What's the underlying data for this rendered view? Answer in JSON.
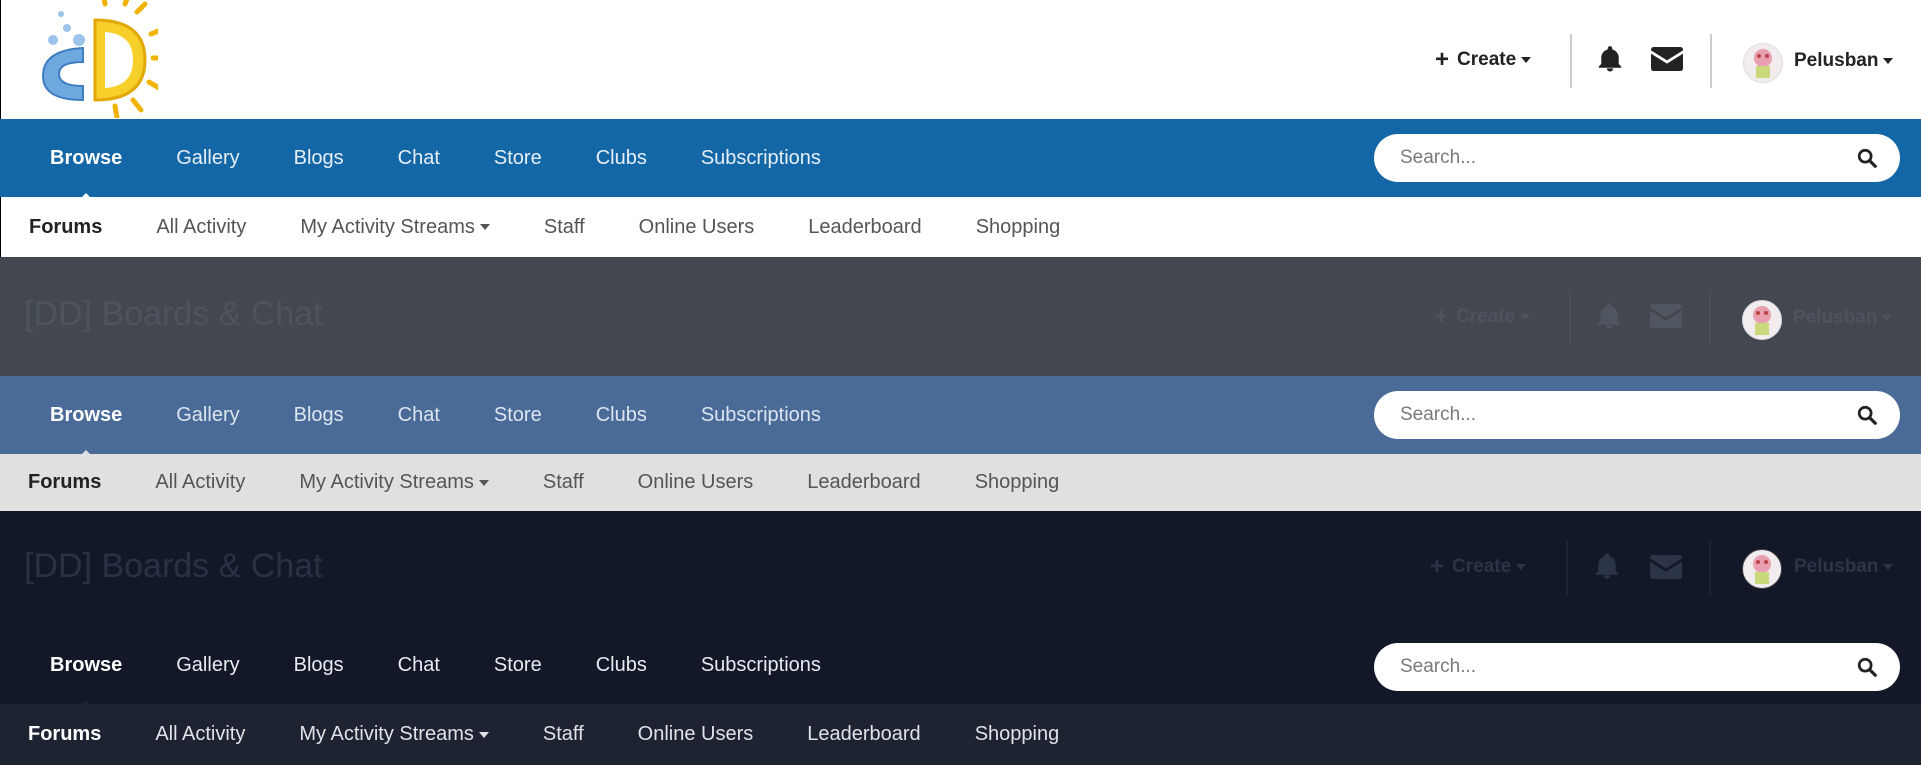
{
  "site_title": "[DD] Boards & Chat",
  "user_bar": {
    "create_label": "Create",
    "username": "Pelusban"
  },
  "nav": {
    "items": [
      "Browse",
      "Gallery",
      "Blogs",
      "Chat",
      "Store",
      "Clubs",
      "Subscriptions"
    ],
    "active": "Browse"
  },
  "search": {
    "placeholder": "Search..."
  },
  "subnav": {
    "items": [
      "Forums",
      "All Activity",
      "My Activity Streams",
      "Staff",
      "Online Users",
      "Leaderboard",
      "Shopping"
    ],
    "active": "Forums"
  },
  "themes": [
    {
      "name": "light",
      "nav_color": "#1467a6",
      "header_color": "#ffffff"
    },
    {
      "name": "slate",
      "nav_color": "#4a6b98",
      "header_color": "#424750"
    },
    {
      "name": "dark",
      "nav_color": "#131828",
      "header_color": "#131828"
    }
  ]
}
